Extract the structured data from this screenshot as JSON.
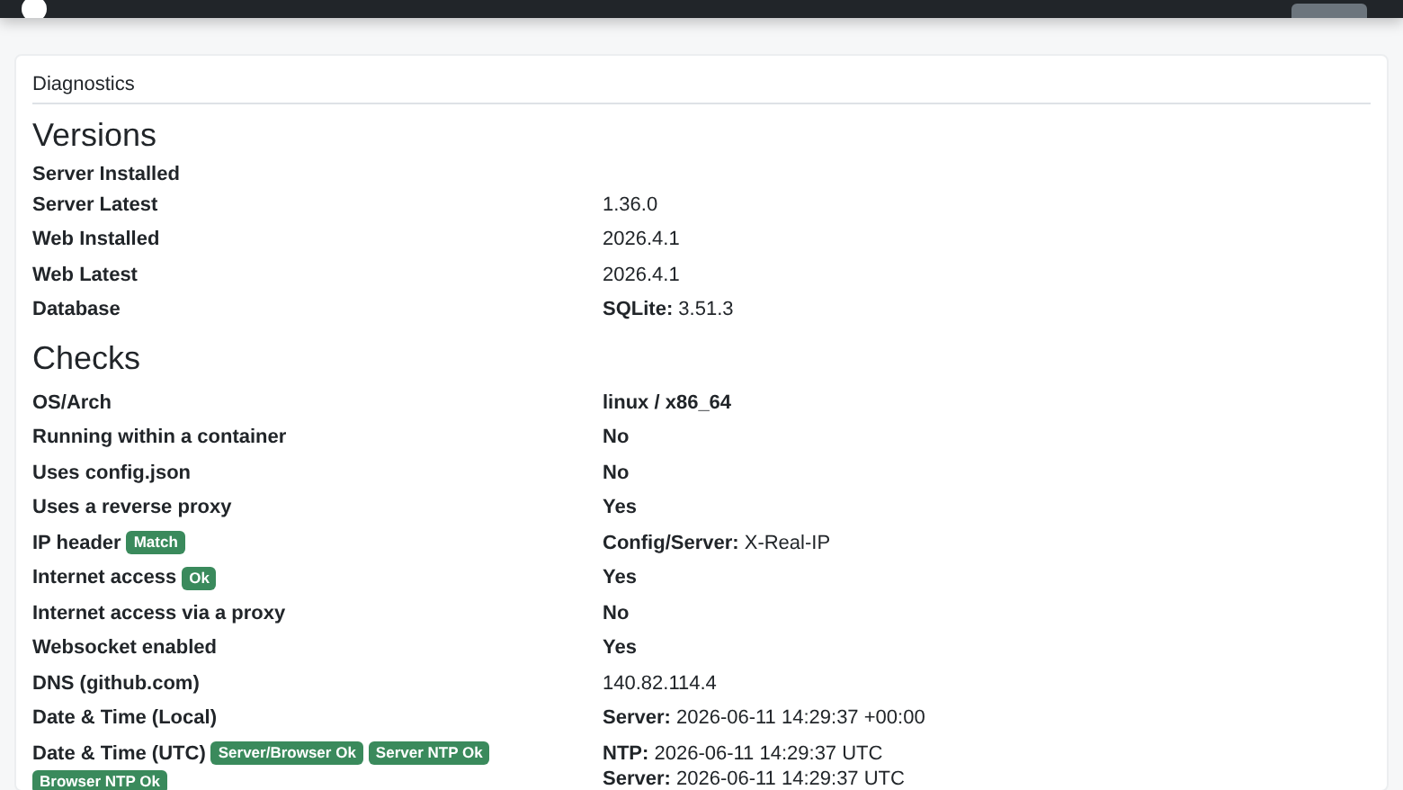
{
  "card_title": "Diagnostics",
  "sections": [
    {
      "title": "Versions",
      "rows": [
        {
          "label": "Server Installed",
          "badges": [],
          "lines": []
        },
        {
          "label": "Server Latest",
          "badges": [],
          "lines": [
            {
              "text": "1.36.0",
              "emphasis": false
            }
          ]
        },
        {
          "label": "Web Installed",
          "badges": [],
          "lines": [
            {
              "text": "2026.4.1",
              "emphasis": false
            }
          ]
        },
        {
          "label": "Web Latest",
          "badges": [],
          "lines": [
            {
              "text": "2026.4.1",
              "emphasis": false
            }
          ]
        },
        {
          "label": "Database",
          "badges": [],
          "lines": [
            {
              "text": "**SQLite:** 3.51.3",
              "emphasis": false
            }
          ]
        }
      ]
    },
    {
      "title": "Checks",
      "rows": [
        {
          "label": "OS/Arch",
          "badges": [],
          "lines": [
            {
              "text": "linux / x86_64",
              "emphasis": true
            }
          ]
        },
        {
          "label": "Running within a container",
          "badges": [],
          "lines": [
            {
              "text": "No",
              "emphasis": true
            }
          ]
        },
        {
          "label": "Uses config.json",
          "badges": [],
          "lines": [
            {
              "text": "No",
              "emphasis": true
            }
          ]
        },
        {
          "label": "Uses a reverse proxy",
          "badges": [],
          "lines": [
            {
              "text": "Yes",
              "emphasis": true
            }
          ]
        },
        {
          "label": "IP header",
          "badges": [
            {
              "text": "Match",
              "color": "#3a8a5c"
            }
          ],
          "lines": [
            {
              "text": "**Config/Server:** X-Real-IP",
              "emphasis": false
            }
          ]
        },
        {
          "label": "Internet access",
          "badges": [
            {
              "text": "Ok",
              "color": "#3a8a5c"
            }
          ],
          "lines": [
            {
              "text": "Yes",
              "emphasis": true
            }
          ]
        },
        {
          "label": "Internet access via a proxy",
          "badges": [],
          "lines": [
            {
              "text": "No",
              "emphasis": true
            }
          ]
        },
        {
          "label": "Websocket enabled",
          "badges": [],
          "lines": [
            {
              "text": "Yes",
              "emphasis": true
            }
          ]
        },
        {
          "label": "DNS (github.com)",
          "badges": [],
          "lines": [
            {
              "text": "140.82.114.4",
              "emphasis": false
            }
          ]
        },
        {
          "label": "Date & Time (Local)",
          "badges": [],
          "lines": [
            {
              "text": "**Server:** 2026-06-11 14:29:37 +00:00",
              "emphasis": false
            }
          ]
        },
        {
          "label": "Date & Time (UTC)",
          "badges": [
            {
              "text": "Server/Browser Ok",
              "color": "#3a8a5c"
            },
            {
              "text": "Server NTP Ok",
              "color": "#3a8a5c"
            },
            {
              "text": "Browser NTP Ok",
              "color": "#3a8a5c"
            }
          ],
          "lines": [
            {
              "text": "**NTP:** 2026-06-11 14:29:37 UTC",
              "emphasis": false
            },
            {
              "text": "**Server:** 2026-06-11 14:29:37 UTC",
              "emphasis": false
            }
          ]
        }
      ]
    }
  ]
}
